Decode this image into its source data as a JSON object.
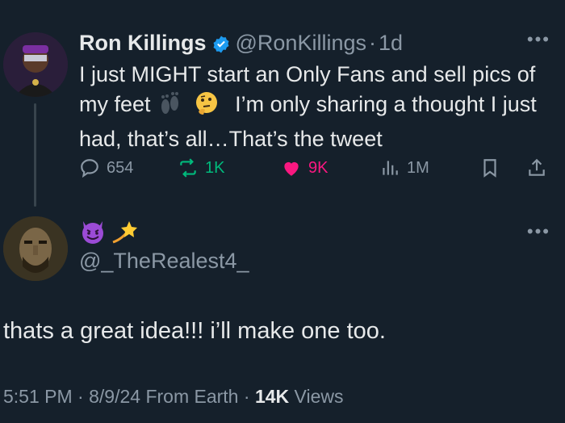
{
  "tweet": {
    "author_name": "Ron Killings",
    "handle": "@RonKillings",
    "dot": "·",
    "time": "1d",
    "text_1": "I just MIGHT start an Only Fans  and sell pics of my feet",
    "text_2": "I’m only sharing a thought I just had, that’s all…That’s the tweet",
    "stats": {
      "replies": "654",
      "reposts": "1K",
      "likes": "9K",
      "views": "1M"
    }
  },
  "reply": {
    "handle": "@_TheRealest4_",
    "text": "thats a great idea!!! i’ll make one too.",
    "time": "5:51 PM",
    "date": "8/9/24",
    "source": "From Earth",
    "views_count": "14K",
    "views_label": "Views",
    "sep": "·"
  },
  "colors": {
    "background": "#15202b",
    "text": "#e7e9ea",
    "secondary": "#8b98a5",
    "verified": "#1d9bf0",
    "repost": "#00ba7c",
    "like": "#f91880"
  },
  "icons": [
    "verified-badge-icon",
    "more-icon",
    "reply-icon",
    "repost-icon",
    "heart-icon",
    "views-icon",
    "bookmark-icon",
    "share-icon",
    "footprints-emoji",
    "thinking-face-emoji",
    "smiling-devil-emoji",
    "dizzy-emoji"
  ]
}
